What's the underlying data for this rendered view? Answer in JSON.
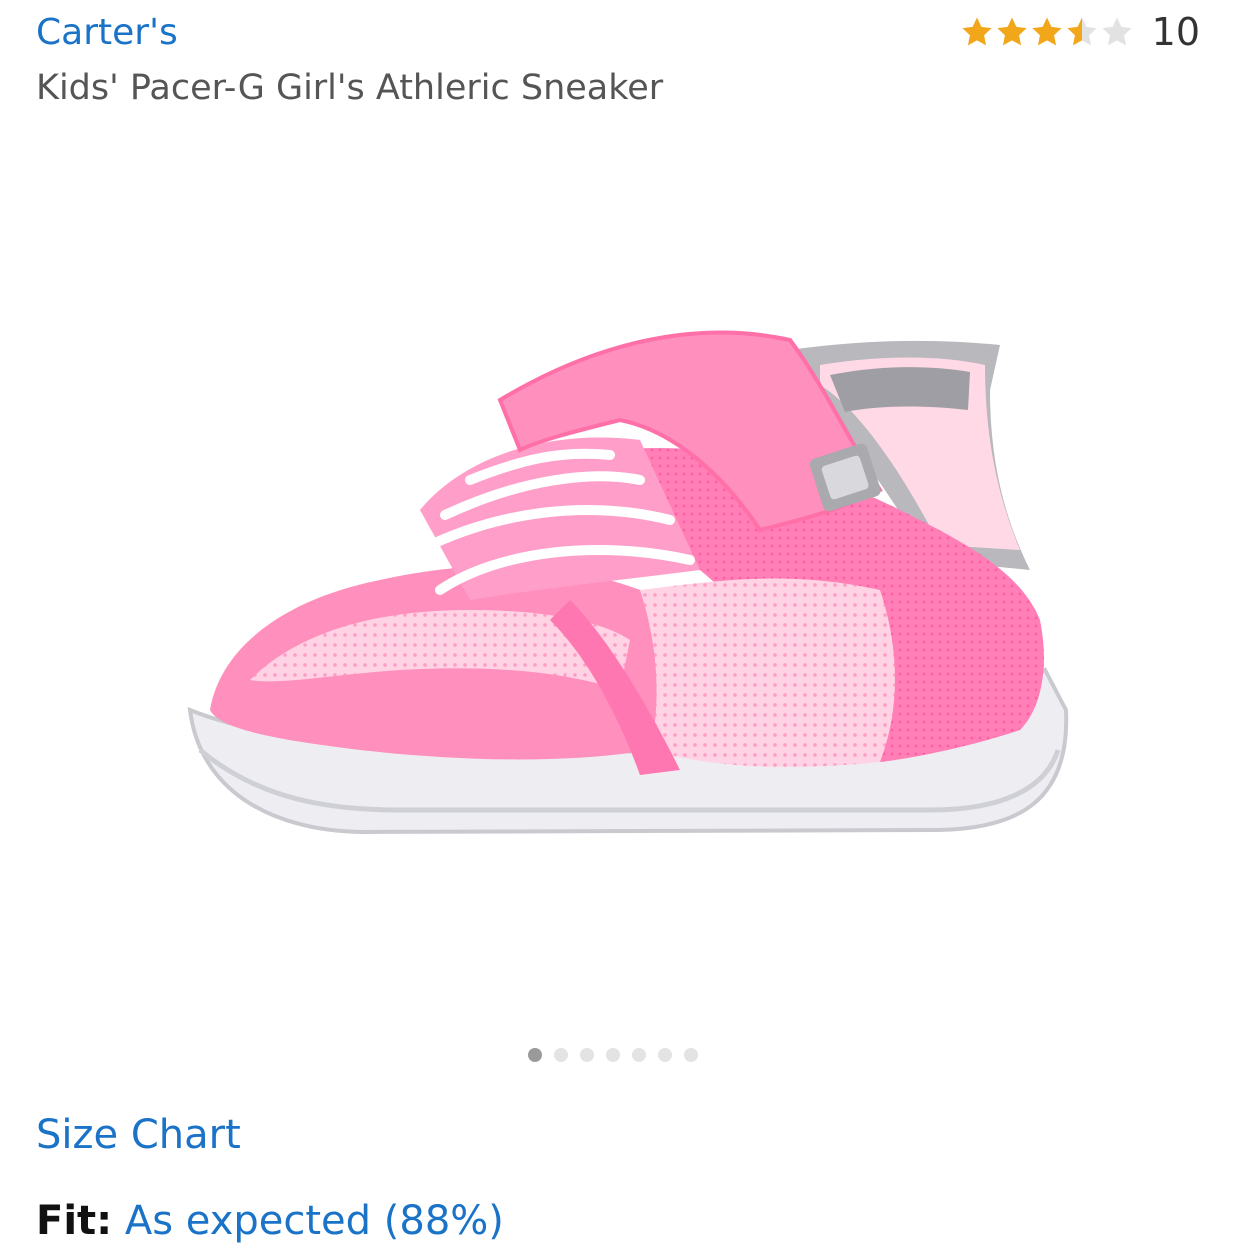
{
  "product": {
    "brand": "Carter's",
    "title": "Kids' Pacer-G Girl's Athleric Sneaker"
  },
  "rating": {
    "stars": 3.5,
    "max_stars": 5,
    "count": "10",
    "star_color": "#f2a71b",
    "empty_star_color": "#e2e2e2"
  },
  "gallery": {
    "image_count": 7,
    "active_index": 0,
    "image_icon": "pink-sneaker-image"
  },
  "links": {
    "size_chart": "Size Chart"
  },
  "fit": {
    "label": "Fit:",
    "value": "As expected (88%)"
  },
  "colors": {
    "link": "#1a73c7",
    "shoe_pink": "#ff8fbd",
    "shoe_light_pink": "#ffd6e7",
    "sole": "#eeeef2"
  }
}
